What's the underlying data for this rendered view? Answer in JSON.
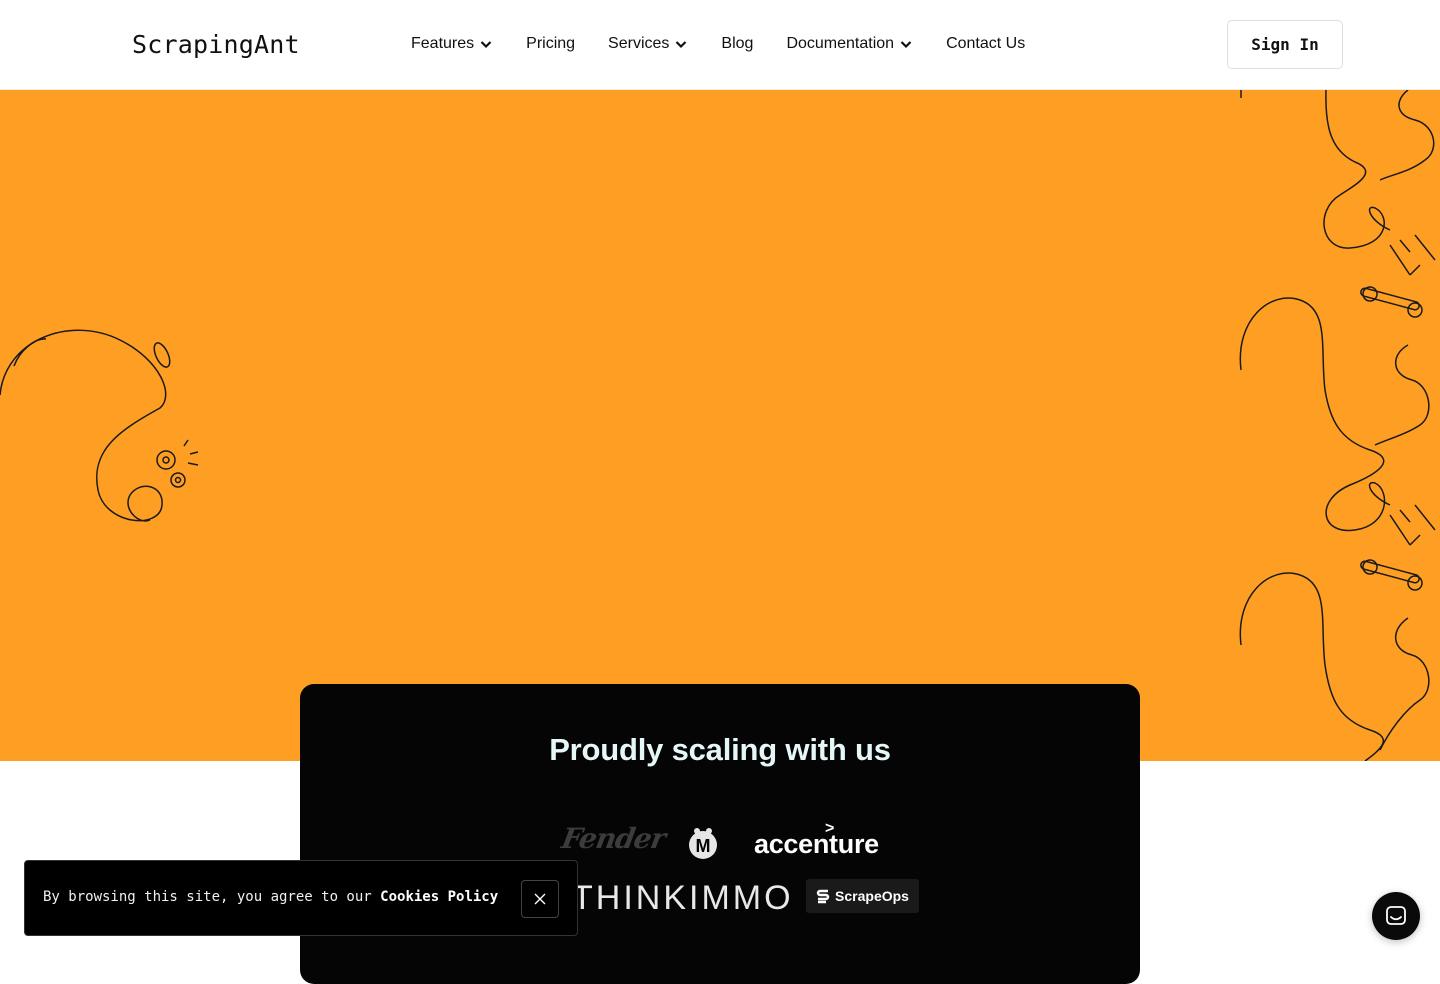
{
  "brand": {
    "name": "ScrapingAnt"
  },
  "nav": {
    "items": [
      {
        "label": "Features",
        "has_dropdown": true
      },
      {
        "label": "Pricing",
        "has_dropdown": false
      },
      {
        "label": "Services",
        "has_dropdown": true
      },
      {
        "label": "Blog",
        "has_dropdown": false
      },
      {
        "label": "Documentation",
        "has_dropdown": true
      },
      {
        "label": "Contact Us",
        "has_dropdown": false
      }
    ],
    "sign_in": "Sign In"
  },
  "hero": {
    "background_color": "#fe9f24"
  },
  "clients": {
    "title": "Proudly scaling with us",
    "logos": {
      "fender": "Fender",
      "m": "M",
      "accenture": "accenture",
      "thinkimmo": "THINKIMMO",
      "scrapeops": "ScrapeOps"
    }
  },
  "cookie": {
    "text": "By browsing this site, you agree to our ",
    "link": "Cookies Policy",
    "close_icon": "close-icon"
  },
  "chat": {
    "icon": "chat-icon"
  }
}
